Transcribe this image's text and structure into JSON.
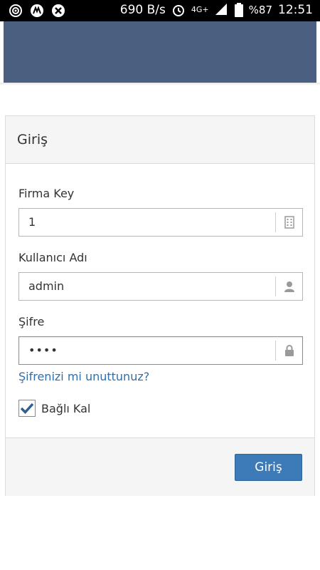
{
  "status_bar": {
    "net_speed": "690 B/s",
    "network": "4G+",
    "battery": "%87",
    "time": "12:51",
    "icons": [
      "hotspot-icon",
      "app-icon",
      "blocked-icon",
      "alarm-icon",
      "signal-icon",
      "battery-icon"
    ]
  },
  "colors": {
    "banner": "#4b5f80",
    "button": "#3d7bb8",
    "link": "#2f6fad"
  },
  "login": {
    "title": "Giriş",
    "firma_key_label": "Firma Key",
    "firma_key_value": "1",
    "username_label": "Kullanıcı Adı",
    "username_value": "admin",
    "password_label": "Şifre",
    "password_value": "••••",
    "forgot_link": "Şifrenizi mi unuttunuz?",
    "remember_label": "Bağlı Kal",
    "remember_checked": true,
    "submit_label": "Giriş"
  }
}
